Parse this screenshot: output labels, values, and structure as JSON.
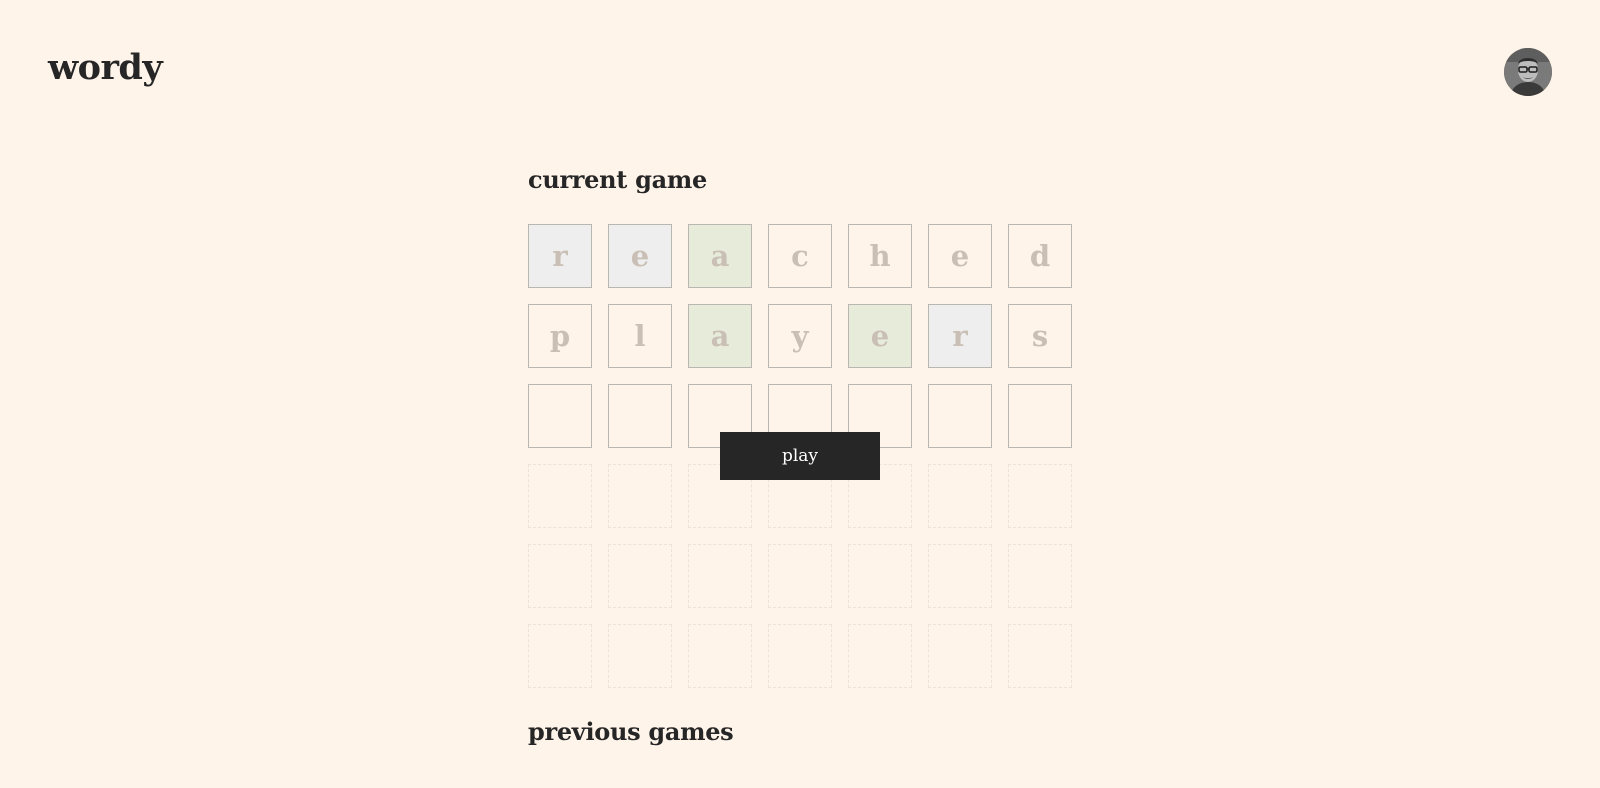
{
  "app": {
    "logo": "wordy"
  },
  "user": {
    "avatar_label": "user avatar"
  },
  "current_game": {
    "title": "current game",
    "rows": [
      {
        "state": "guessed",
        "tiles": [
          {
            "letter": "r",
            "status": "present"
          },
          {
            "letter": "e",
            "status": "present"
          },
          {
            "letter": "a",
            "status": "correct"
          },
          {
            "letter": "c",
            "status": "absent"
          },
          {
            "letter": "h",
            "status": "absent"
          },
          {
            "letter": "e",
            "status": "absent"
          },
          {
            "letter": "d",
            "status": "absent"
          }
        ]
      },
      {
        "state": "guessed",
        "tiles": [
          {
            "letter": "p",
            "status": "absent"
          },
          {
            "letter": "l",
            "status": "absent"
          },
          {
            "letter": "a",
            "status": "correct"
          },
          {
            "letter": "y",
            "status": "absent"
          },
          {
            "letter": "e",
            "status": "correct"
          },
          {
            "letter": "r",
            "status": "present"
          },
          {
            "letter": "s",
            "status": "absent"
          }
        ]
      },
      {
        "state": "active",
        "tiles": [
          {
            "letter": "",
            "status": "empty"
          },
          {
            "letter": "",
            "status": "empty"
          },
          {
            "letter": "",
            "status": "empty"
          },
          {
            "letter": "",
            "status": "empty"
          },
          {
            "letter": "",
            "status": "empty"
          },
          {
            "letter": "",
            "status": "empty"
          },
          {
            "letter": "",
            "status": "empty"
          }
        ]
      },
      {
        "state": "locked",
        "tiles": [
          {
            "letter": "",
            "status": "locked"
          },
          {
            "letter": "",
            "status": "locked"
          },
          {
            "letter": "",
            "status": "locked"
          },
          {
            "letter": "",
            "status": "locked"
          },
          {
            "letter": "",
            "status": "locked"
          },
          {
            "letter": "",
            "status": "locked"
          },
          {
            "letter": "",
            "status": "locked"
          }
        ]
      },
      {
        "state": "locked",
        "tiles": [
          {
            "letter": "",
            "status": "locked"
          },
          {
            "letter": "",
            "status": "locked"
          },
          {
            "letter": "",
            "status": "locked"
          },
          {
            "letter": "",
            "status": "locked"
          },
          {
            "letter": "",
            "status": "locked"
          },
          {
            "letter": "",
            "status": "locked"
          },
          {
            "letter": "",
            "status": "locked"
          }
        ]
      },
      {
        "state": "locked",
        "tiles": [
          {
            "letter": "",
            "status": "locked"
          },
          {
            "letter": "",
            "status": "locked"
          },
          {
            "letter": "",
            "status": "locked"
          },
          {
            "letter": "",
            "status": "locked"
          },
          {
            "letter": "",
            "status": "locked"
          },
          {
            "letter": "",
            "status": "locked"
          },
          {
            "letter": "",
            "status": "locked"
          }
        ]
      }
    ],
    "play_label": "play"
  },
  "previous_games": {
    "title": "previous games"
  },
  "colors": {
    "background": "#fff4ea",
    "text": "#262626",
    "tile_letter": "#c9bfb4",
    "present": "#eeeeee",
    "correct": "#e7ecda",
    "button": "#262626"
  }
}
